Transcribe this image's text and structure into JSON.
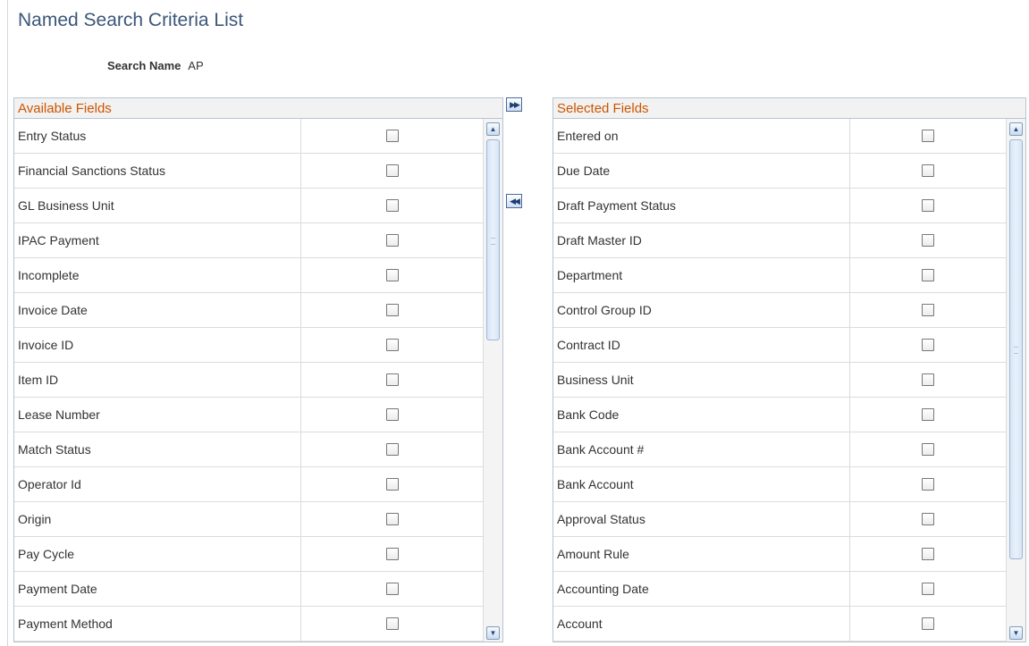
{
  "page": {
    "title": "Named Search Criteria List"
  },
  "search": {
    "label": "Search Name",
    "value": "AP"
  },
  "available": {
    "header": "Available Fields",
    "rows": [
      "Entry Status",
      "Financial Sanctions Status",
      "GL Business Unit",
      "IPAC Payment",
      "Incomplete",
      "Invoice Date",
      "Invoice ID",
      "Item ID",
      "Lease Number",
      "Match Status",
      "Operator Id",
      "Origin",
      "Pay Cycle",
      "Payment Date",
      "Payment Method"
    ],
    "scroll_position": 0.0
  },
  "selected": {
    "header": "Selected Fields",
    "rows": [
      "Entered on",
      "Due Date",
      "Draft Payment Status",
      "Draft Master ID",
      "Department",
      "Control Group ID",
      "Contract ID",
      "Business Unit",
      "Bank Code",
      "Bank Account #",
      "Bank Account",
      "Approval Status",
      "Amount Rule",
      "Accounting Date",
      "Account"
    ],
    "scroll_position": 0.0
  },
  "icons": {
    "move_right": "double-right-arrow-icon",
    "move_left": "double-left-arrow-icon",
    "scroll_up": "scroll-up-arrow-icon",
    "scroll_down": "scroll-down-arrow-icon"
  },
  "colors": {
    "title": "#3b5679",
    "grid_header_text": "#cc5500",
    "border": "#b9c4cf"
  }
}
